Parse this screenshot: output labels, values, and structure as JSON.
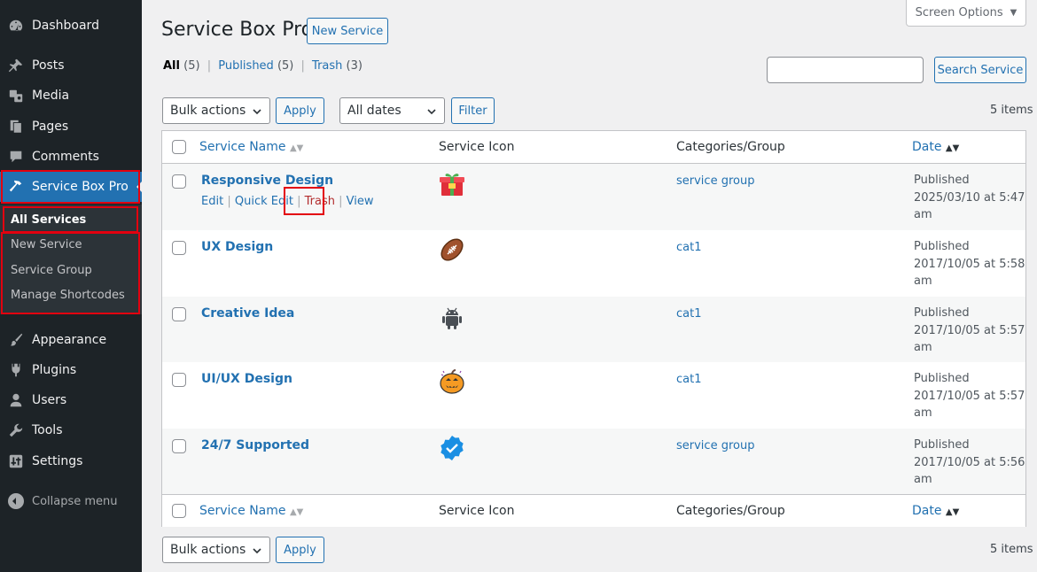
{
  "sidebar": {
    "items": [
      {
        "label": "Dashboard",
        "icon": "dashboard-icon"
      },
      {
        "label": "Posts",
        "icon": "pushpin-icon"
      },
      {
        "label": "Media",
        "icon": "media-icon"
      },
      {
        "label": "Pages",
        "icon": "pages-icon"
      },
      {
        "label": "Comments",
        "icon": "comment-icon"
      },
      {
        "label": "Service Box Pro",
        "icon": "hammer-icon"
      },
      {
        "label": "Appearance",
        "icon": "paintbrush-icon"
      },
      {
        "label": "Plugins",
        "icon": "plugin-icon"
      },
      {
        "label": "Users",
        "icon": "users-icon"
      },
      {
        "label": "Tools",
        "icon": "wrench-icon"
      },
      {
        "label": "Settings",
        "icon": "settings-icon"
      }
    ],
    "submenu": [
      "All Services",
      "New Service",
      "Service Group",
      "Manage Shortcodes"
    ],
    "collapse": "Collapse menu"
  },
  "header": {
    "title": "Service Box Pro",
    "new_button": "New Service",
    "screen_options": "Screen Options"
  },
  "filters": {
    "all": "All",
    "all_count": "(5)",
    "published": "Published",
    "published_count": "(5)",
    "trash": "Trash",
    "trash_count": "(3)",
    "sep": "|"
  },
  "search": {
    "placeholder": "",
    "button": "Search Service"
  },
  "toolbar": {
    "bulk": "Bulk actions",
    "apply": "Apply",
    "dates": "All dates",
    "filter": "Filter",
    "count": "5 items"
  },
  "columns": {
    "name": "Service Name",
    "icon": "Service Icon",
    "categories": "Categories/Group",
    "date": "Date"
  },
  "rows": [
    {
      "title": "Responsive Design",
      "icon": "gift-icon",
      "category": "service group",
      "status": "Published",
      "date": "2025/03/10 at 5:47",
      "ampm": "am"
    },
    {
      "title": "UX Design",
      "icon": "football-icon",
      "category": "cat1",
      "status": "Published",
      "date": "2017/10/05 at 5:58",
      "ampm": "am"
    },
    {
      "title": "Creative Idea",
      "icon": "android-icon",
      "category": "cat1",
      "status": "Published",
      "date": "2017/10/05 at 5:57",
      "ampm": "am"
    },
    {
      "title": "UI/UX Design",
      "icon": "pumpkin-icon",
      "category": "cat1",
      "status": "Published",
      "date": "2017/10/05 at 5:57",
      "ampm": "am"
    },
    {
      "title": "24/7 Supported",
      "icon": "verified-badge-icon",
      "category": "service group",
      "status": "Published",
      "date": "2017/10/05 at 5:56",
      "ampm": "am"
    }
  ],
  "row_actions": {
    "edit": "Edit",
    "quick_edit": "Quick Edit",
    "trash": "Trash",
    "view": "View",
    "sep": "|"
  },
  "colors": {
    "sidebar": "#1d2327",
    "accent": "#2271b1",
    "highlight": "#e3000f"
  }
}
